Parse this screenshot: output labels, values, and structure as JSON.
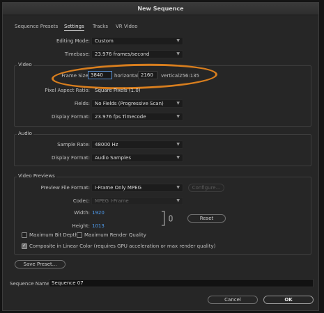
{
  "window": {
    "title": "New Sequence"
  },
  "tabs": [
    {
      "label": "Sequence Presets"
    },
    {
      "label": "Settings",
      "active": true
    },
    {
      "label": "Tracks"
    },
    {
      "label": "VR Video"
    }
  ],
  "editing_mode": {
    "label": "Editing Mode:",
    "value": "Custom"
  },
  "timebase": {
    "label": "Timebase:",
    "value": "23.976  frames/second"
  },
  "video": {
    "section_label": "Video",
    "frame_size_label": "Frame Size:",
    "width": "3840",
    "horizontal_label": "horizontal",
    "height": "2160",
    "vertical_label": "vertical",
    "ratio": "256:135",
    "pixel_aspect_label": "Pixel Aspect Ratio:",
    "pixel_aspect_value": "Square Pixels (1.0)",
    "fields_label": "Fields:",
    "fields_value": "No Fields (Progressive Scan)",
    "display_format_label": "Display Format:",
    "display_format_value": "23.976 fps Timecode"
  },
  "audio": {
    "section_label": "Audio",
    "sample_rate_label": "Sample Rate:",
    "sample_rate_value": "48000 Hz",
    "display_format_label": "Display Format:",
    "display_format_value": "Audio Samples"
  },
  "previews": {
    "section_label": "Video Previews",
    "file_format_label": "Preview File Format:",
    "file_format_value": "I-Frame Only MPEG",
    "configure_label": "Configure...",
    "codec_label": "Codec:",
    "codec_value": "MPEG I-Frame",
    "width_label": "Width:",
    "width_value": "1920",
    "height_label": "Height:",
    "height_value": "1013",
    "reset_label": "Reset"
  },
  "options": {
    "max_bit_depth": "Maximum Bit Depth",
    "max_render_quality": "Maximum Render Quality",
    "linear_color": "Composite in Linear Color (requires GPU acceleration or max render quality)"
  },
  "save_preset_label": "Save Preset...",
  "sequence_name": {
    "label": "Sequence Name:",
    "value": "Sequence 07"
  },
  "footer": {
    "cancel_label": "Cancel",
    "ok_label": "OK"
  },
  "colors": {
    "highlight": "#d87e1e",
    "accent_blue": "#4e9cf0"
  },
  "icons": {
    "dropdown": "chevron-down-icon",
    "link": "chain-link-icon"
  }
}
